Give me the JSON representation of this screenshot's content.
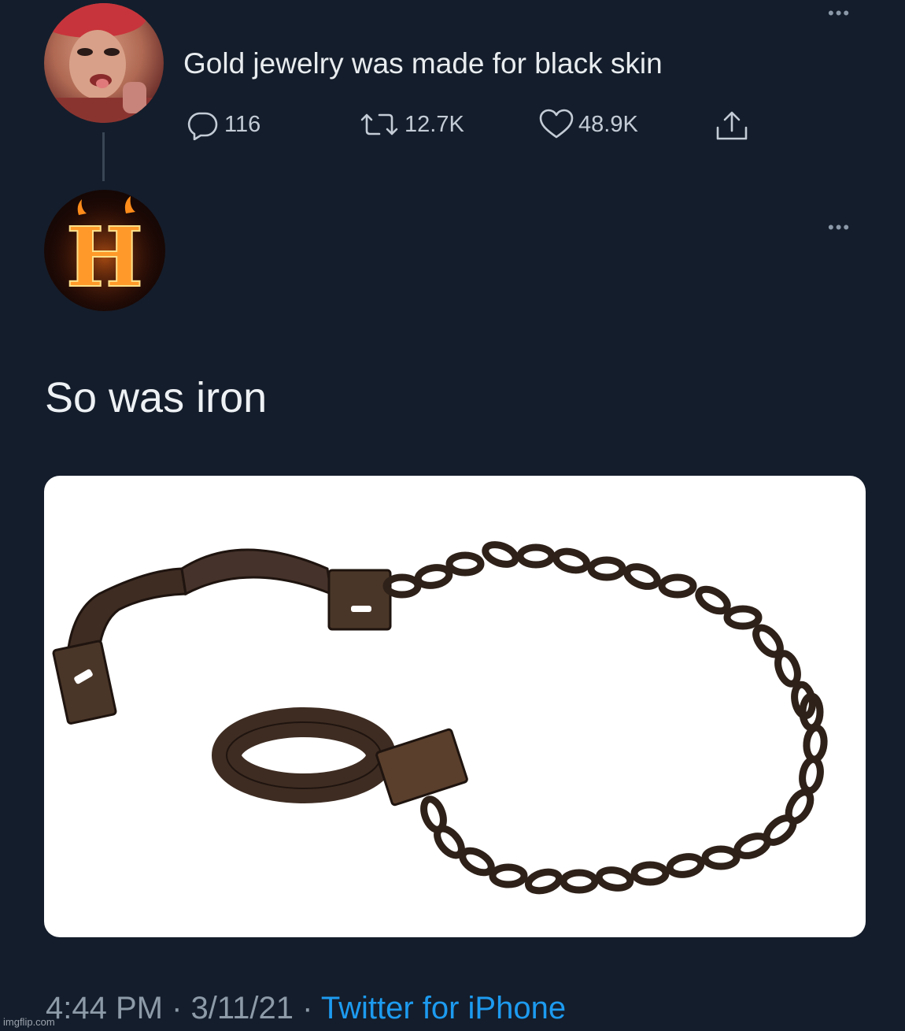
{
  "tweet1": {
    "text": "Gold jewelry was made for black skin",
    "more_label": "•••",
    "stats": {
      "replies": "116",
      "retweets": "12.7K",
      "likes": "48.9K"
    }
  },
  "tweet2": {
    "avatar_letter": "H",
    "more_label": "•••",
    "text": "So was iron",
    "media": {
      "subject": "iron shackles with chain",
      "background": "#ffffff"
    }
  },
  "footer": {
    "time": "4:44 PM",
    "sep1": " · ",
    "date": "3/11/21",
    "sep2": " · ",
    "source": "Twitter for iPhone"
  },
  "watermark": "imgflip.com",
  "colors": {
    "background": "#141d2b",
    "text": "#e8ecef",
    "muted": "#8d9aa8",
    "link": "#1d9bf0",
    "thread_line": "#3a4655"
  },
  "icons": [
    "reply-icon",
    "retweet-icon",
    "like-icon",
    "share-icon",
    "more-icon"
  ]
}
